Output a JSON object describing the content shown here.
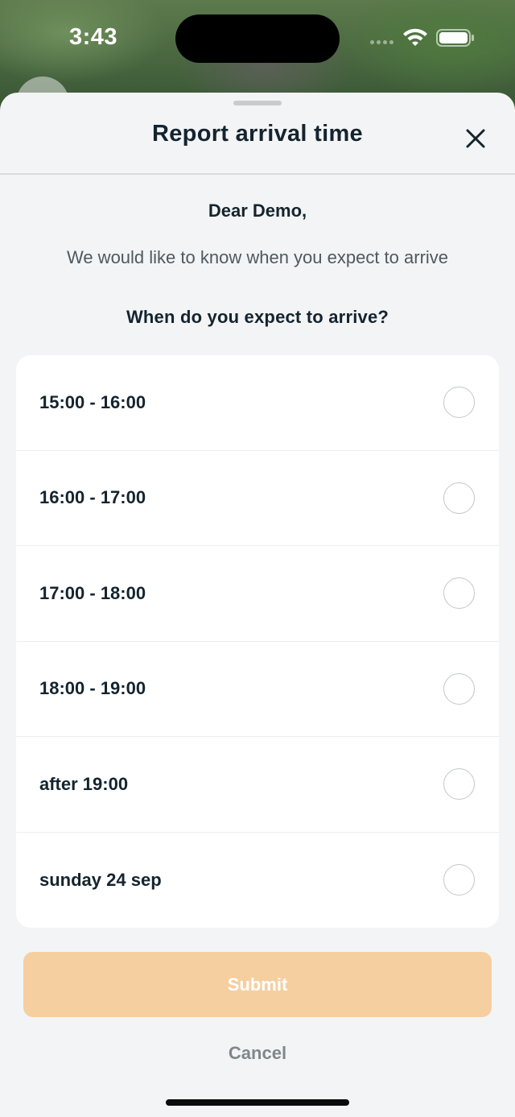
{
  "status_bar": {
    "time": "3:43"
  },
  "sheet": {
    "title": "Report arrival time",
    "greeting": "Dear Demo,",
    "subtitle": "We would like to know when you expect to arrive",
    "question": "When do you expect to arrive?",
    "options": [
      {
        "label": "15:00 - 16:00",
        "selected": false
      },
      {
        "label": "16:00 - 17:00",
        "selected": false
      },
      {
        "label": "17:00 - 18:00",
        "selected": false
      },
      {
        "label": "18:00 - 19:00",
        "selected": false
      },
      {
        "label": "after 19:00",
        "selected": false
      },
      {
        "label": "sunday 24 sep",
        "selected": false
      }
    ],
    "submit_label": "Submit",
    "cancel_label": "Cancel"
  },
  "colors": {
    "accent_disabled": "#f6cfa0",
    "text_primary": "#14242f",
    "text_secondary": "#4d5961",
    "sheet_background": "#f3f4f5"
  },
  "icons": {
    "close": "close-icon",
    "wifi": "wifi-icon",
    "battery": "battery-icon",
    "signal": "signal-icon"
  }
}
